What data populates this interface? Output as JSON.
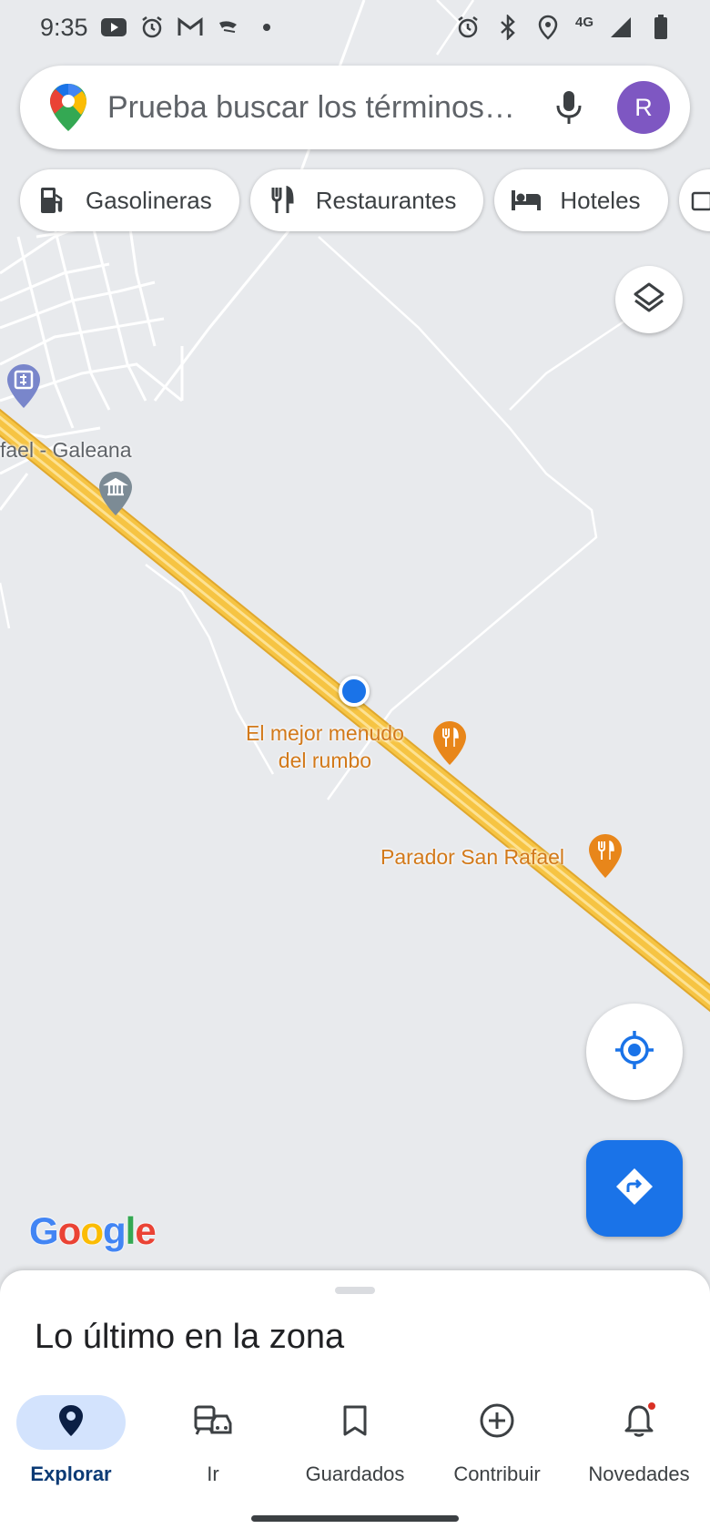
{
  "status_bar": {
    "time": "9:35",
    "network": "4G"
  },
  "search": {
    "placeholder": "Prueba buscar los términos…",
    "avatar_letter": "R"
  },
  "chips": [
    {
      "label": "Gasolineras",
      "icon": "gas-station-icon"
    },
    {
      "label": "Restaurantes",
      "icon": "restaurant-icon"
    },
    {
      "label": "Hoteles",
      "icon": "hotel-icon"
    }
  ],
  "map": {
    "town_label": "fael - Galeana",
    "pois": [
      {
        "label_line1": "El mejor menudo",
        "label_line2": "del rumbo",
        "icon": "restaurant-pin-icon"
      },
      {
        "label_line1": "Parador San Rafael",
        "label_line2": "",
        "icon": "restaurant-pin-icon"
      }
    ],
    "colors": {
      "highway": "#f6c443",
      "highway_center": "#fde293",
      "poi": "#e8861a",
      "road": "#ffffff"
    }
  },
  "attribution": "Google",
  "bottom_sheet": {
    "title": "Lo último en la zona"
  },
  "nav": [
    {
      "label": "Explorar",
      "icon": "explore-pin-icon",
      "active": true
    },
    {
      "label": "Ir",
      "icon": "commute-icon",
      "active": false
    },
    {
      "label": "Guardados",
      "icon": "bookmark-icon",
      "active": false
    },
    {
      "label": "Contribuir",
      "icon": "add-circle-icon",
      "active": false
    },
    {
      "label": "Novedades",
      "icon": "bell-icon",
      "active": false
    }
  ],
  "accent_color": "#1a73e8"
}
